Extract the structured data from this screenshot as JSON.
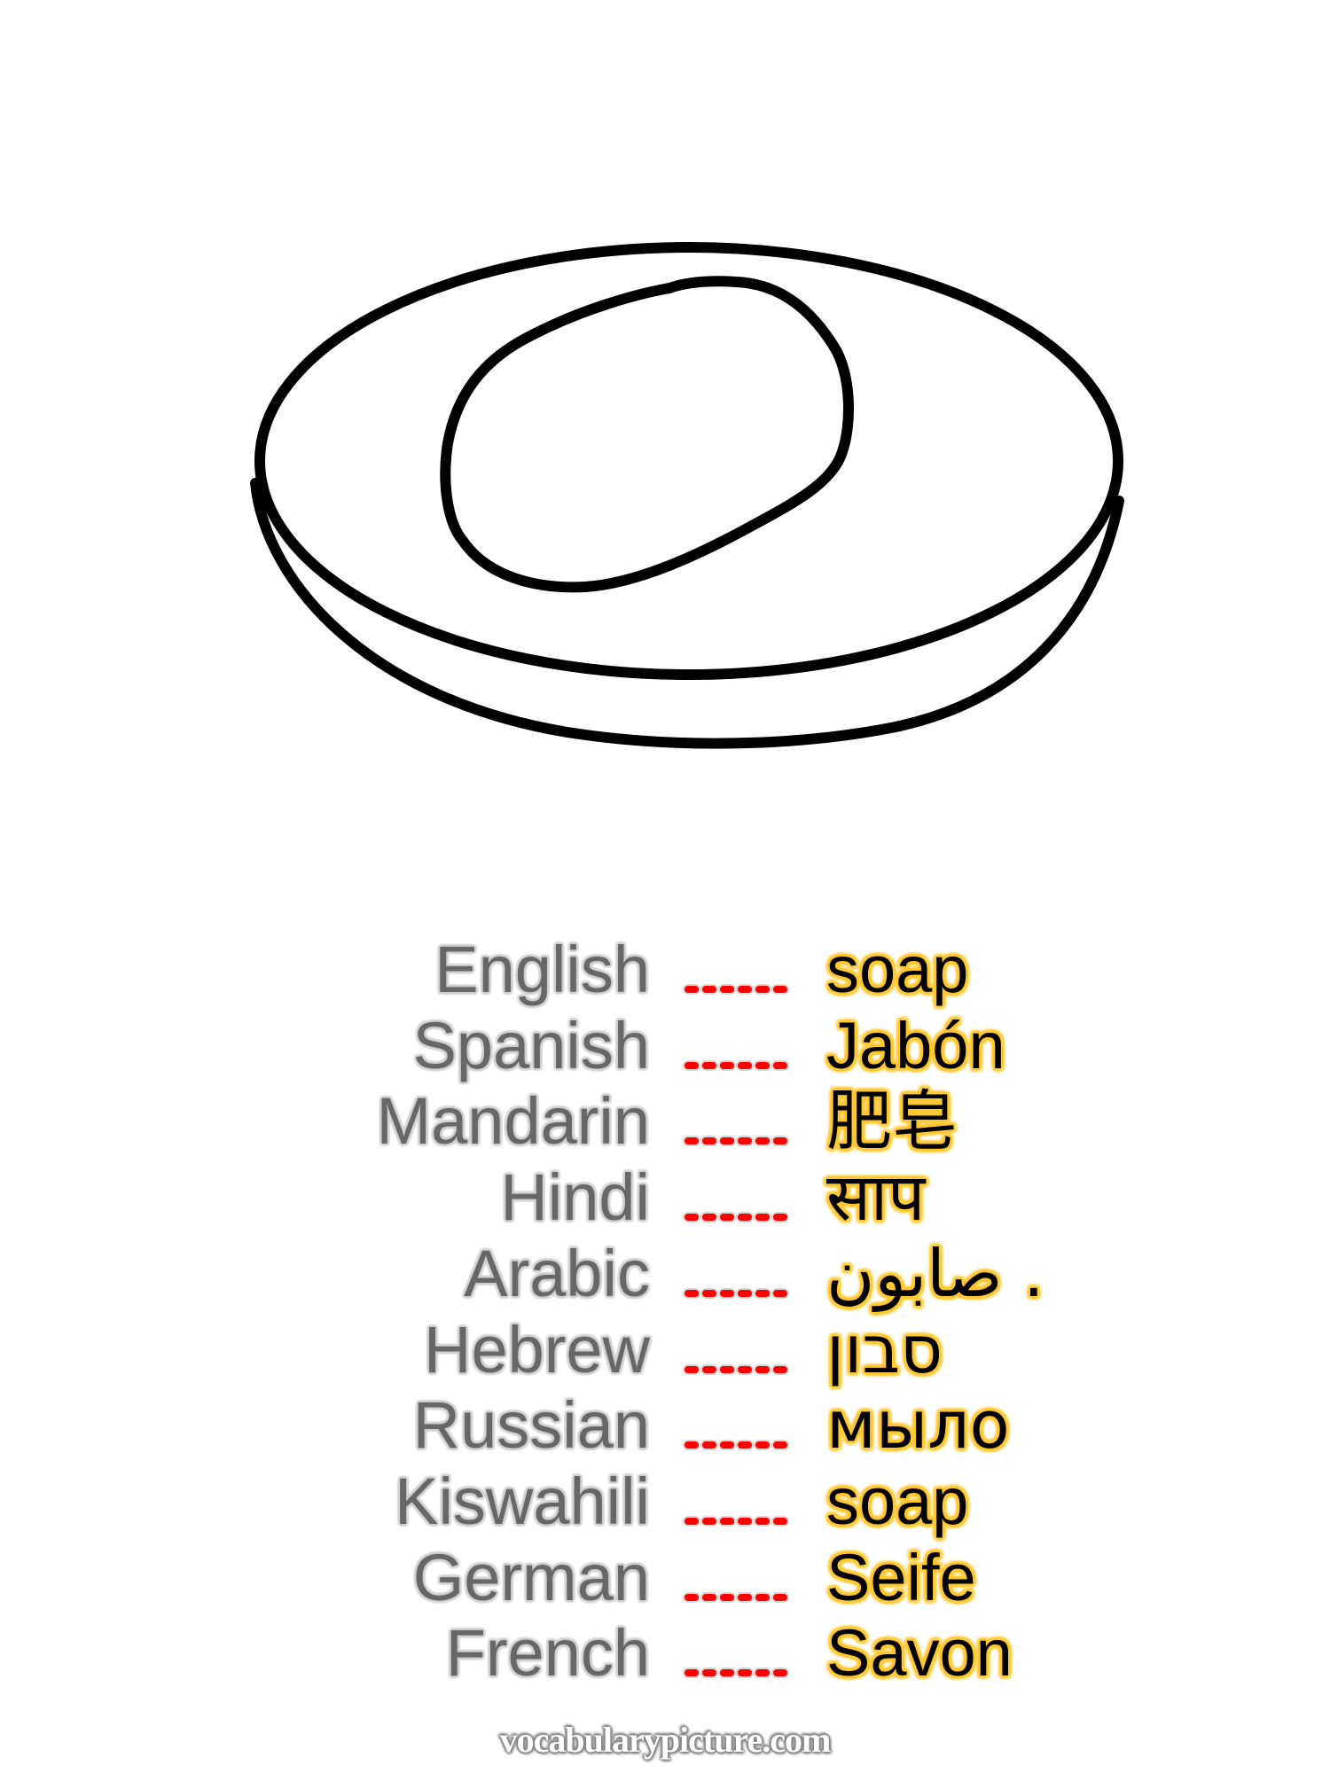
{
  "illustration": {
    "subject": "soap",
    "description": "line drawing of a bar of soap on a round soap dish"
  },
  "translations": [
    {
      "language": "English",
      "word": "soap"
    },
    {
      "language": "Spanish",
      "word": "Jabón"
    },
    {
      "language": "Mandarin",
      "word": "肥皂"
    },
    {
      "language": "Hindi",
      "word": "साप"
    },
    {
      "language": "Arabic",
      "word": "صابون ."
    },
    {
      "language": "Hebrew",
      "word": "סבון"
    },
    {
      "language": "Russian",
      "word": "мыло"
    },
    {
      "language": "Kiswahili",
      "word": "soap"
    },
    {
      "language": "German",
      "word": "Seife"
    },
    {
      "language": "French",
      "word": "Savon"
    }
  ],
  "separator": {
    "dash_count": 6,
    "color": "#ff0000"
  },
  "colors": {
    "label_text": "#676767",
    "label_outline": "#cfcfcf",
    "translation_text": "#000000",
    "translation_glow": "#ffc72c",
    "watermark_text": "#ffffff",
    "watermark_outline": "#8a8a8a"
  },
  "watermark": "vocabularypicture.com"
}
